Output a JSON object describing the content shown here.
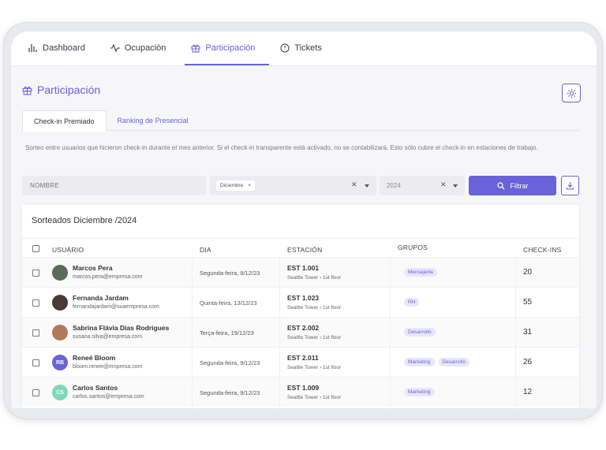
{
  "nav": {
    "tabs": [
      {
        "label": "Dashboard",
        "icon": "chart-bars-icon",
        "active": false
      },
      {
        "label": "Ocupación",
        "icon": "activity-icon",
        "active": false
      },
      {
        "label": "Participación",
        "icon": "gift-icon",
        "active": true
      },
      {
        "label": "Tickets",
        "icon": "clock-icon",
        "active": false
      }
    ]
  },
  "page": {
    "title": "Participación",
    "title_icon": "gift-icon",
    "settings_icon": "gear-icon"
  },
  "subtabs": [
    {
      "label": "Check-in Premiado",
      "active": true
    },
    {
      "label": "Ranking de Presencial",
      "active": false
    }
  ],
  "description": "Sorteo entre usuarios que hicieron check-in durante el mes anterior. Si el check-in transparente está activado, no se contabilizará. Esto sólo cubre el check-in en estaciones de trabajo.",
  "filters": {
    "name_placeholder": "NOMBRE",
    "month_chip": "Diciembre",
    "year_value": "2024",
    "filter_button": "Filtrar"
  },
  "table": {
    "title": "Sorteados Diciembre /2024",
    "headers": {
      "user": "USUÁRIO",
      "day": "DIA",
      "station": "ESTACIÓN",
      "groups": "GRUPOS",
      "checkins": "CHECK-INS"
    },
    "rows": [
      {
        "name": "Marcos Pera",
        "email": "marcos.pera@empresa.com",
        "day": "Segunda-feira, 9/12/23",
        "station": "EST 1.001",
        "location": "Seattle Tower › 1st floor",
        "groups": [
          "Mensajeria"
        ],
        "checkins": "20",
        "avatar_initials": "",
        "avatar_color": "#5b6b5a"
      },
      {
        "name": "Fernanda Jardam",
        "email": "fernandajardam@suaempresa.com",
        "day": "Quinta-feira, 13/12/23",
        "station": "EST 1.023",
        "location": "Seattle Tower › 1st floor",
        "groups": [
          "RH"
        ],
        "checkins": "55",
        "avatar_initials": "",
        "avatar_color": "#4a3a36"
      },
      {
        "name": "Sabrina Flávia Dias Rodrigues",
        "email": "susana.silva@empresa.com",
        "day": "Terça-feira, 19/12/23",
        "station": "EST 2.002",
        "location": "Seattle Tower › 1st floor",
        "groups": [
          "Desarrollo"
        ],
        "checkins": "31",
        "avatar_initials": "",
        "avatar_color": "#b07a5a"
      },
      {
        "name": "Reneé Bloom",
        "email": "bloom.renee@empresa.com",
        "day": "Segunda-feira, 9/12/23",
        "station": "EST 2.011",
        "location": "Seattle Tower › 1st floor",
        "groups": [
          "Marketing",
          "Desarrollo"
        ],
        "checkins": "26",
        "avatar_initials": "RB",
        "avatar_color": "#6a62d9"
      },
      {
        "name": "Carlos Santos",
        "email": "carlos.santos@empresa.com",
        "day": "Segunda-feira, 9/12/23",
        "station": "EST 1.009",
        "location": "Seattle Tower › 1st floor",
        "groups": [
          "Marketing"
        ],
        "checkins": "12",
        "avatar_initials": "CS",
        "avatar_color": "#7fd8b8"
      }
    ]
  },
  "colors": {
    "accent": "#6a62d9",
    "tag_bg": "#e8e6f8"
  }
}
